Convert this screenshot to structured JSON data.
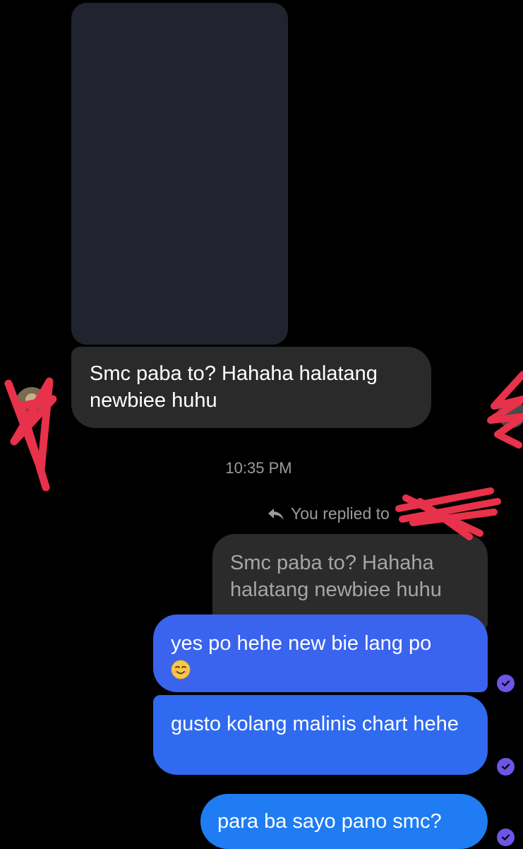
{
  "conversation": {
    "incoming": {
      "text": "Smc paba to? Hahaha halatang newbiee huhu"
    },
    "timestamp": "10:35 PM",
    "reply_indicator": "You replied to",
    "quoted_message": "Smc paba to? Hahaha halatang newbiee huhu",
    "outgoing": [
      {
        "text": "yes po hehe new bie lang po",
        "emoji": "smiling-face"
      },
      {
        "text": "gusto kolang malinis chart hehe"
      },
      {
        "text": "para ba sayo pano smc?"
      }
    ]
  },
  "colors": {
    "background": "#000000",
    "incoming_bubble": "#2a2a2a",
    "media_block": "#21242e",
    "outgoing_bubble_1": "#3a63ee",
    "outgoing_bubble_2": "#2f6af0",
    "outgoing_bubble_3": "#1f7cf2",
    "read_receipt": "#6b56e6",
    "redaction_scribble": "#e8314a"
  },
  "icons": {
    "reply": "reply-arrow-icon",
    "read_receipt": "check-circle-icon",
    "emoji": "smiling-face-emoji-icon"
  }
}
